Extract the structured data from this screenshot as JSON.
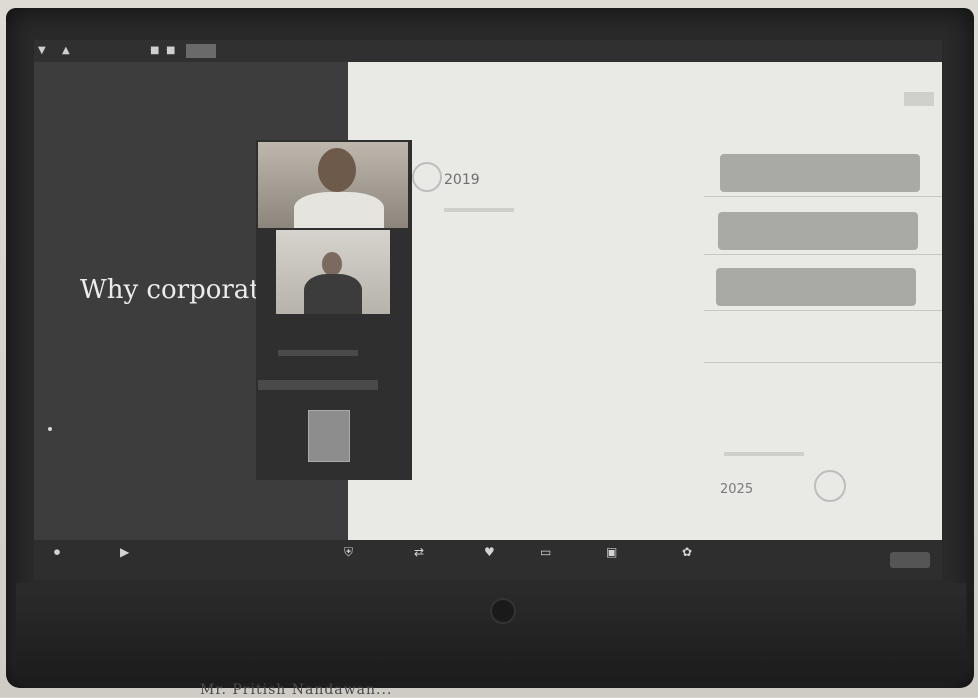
{
  "slide_left": {
    "title": "Why corporate?"
  },
  "timeline": {
    "start_year": "2019",
    "end_year": "2025"
  },
  "caption": "Mr. Pritish Nandawan..."
}
